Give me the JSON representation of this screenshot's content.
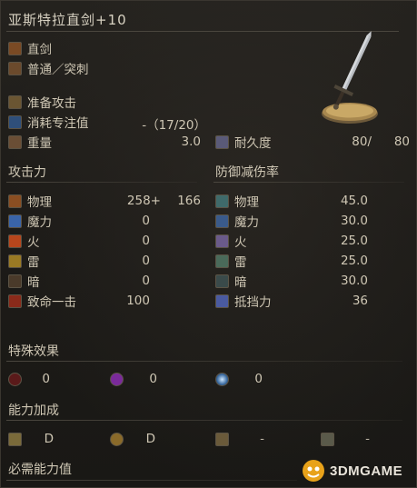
{
  "header": {
    "title": "亚斯特拉直剑+10"
  },
  "weapon": {
    "type": "直剑",
    "attack_type": "普通／突刺",
    "skill": "准备攻击",
    "fp_cost_label": "消耗专注值",
    "fp_cost_value": "-（17/20）",
    "weight_label": "重量",
    "weight_value": "3.0",
    "durability_label": "耐久度",
    "durability_current": "80/",
    "durability_max": "80"
  },
  "attack": {
    "title": "攻击力",
    "rows": [
      {
        "label": "物理",
        "value": "258+",
        "bonus": "166",
        "icon": "physical-attack-icon"
      },
      {
        "label": "魔力",
        "value": "0",
        "icon": "magic-attack-icon"
      },
      {
        "label": "火",
        "value": "0",
        "icon": "fire-attack-icon"
      },
      {
        "label": "雷",
        "value": "0",
        "icon": "lightning-attack-icon"
      },
      {
        "label": "暗",
        "value": "0",
        "icon": "dark-attack-icon"
      },
      {
        "label": "致命一击",
        "value": "100",
        "icon": "critical-icon"
      }
    ]
  },
  "defense": {
    "title": "防御减伤率",
    "rows": [
      {
        "label": "物理",
        "value": "45.0",
        "icon": "physical-defense-icon"
      },
      {
        "label": "魔力",
        "value": "30.0",
        "icon": "magic-defense-icon"
      },
      {
        "label": "火",
        "value": "25.0",
        "icon": "fire-defense-icon"
      },
      {
        "label": "雷",
        "value": "25.0",
        "icon": "lightning-defense-icon"
      },
      {
        "label": "暗",
        "value": "30.0",
        "icon": "dark-defense-icon"
      },
      {
        "label": "抵挡力",
        "value": "36",
        "icon": "stability-icon"
      }
    ]
  },
  "effects": {
    "title": "特殊效果",
    "items": [
      {
        "value": "0",
        "icon": "bleed-icon"
      },
      {
        "value": "0",
        "icon": "poison-icon"
      },
      {
        "value": "0",
        "icon": "frost-icon"
      }
    ]
  },
  "scaling": {
    "title": "能力加成",
    "items": [
      {
        "value": "D",
        "icon": "strength-icon"
      },
      {
        "value": "D",
        "icon": "dexterity-icon"
      },
      {
        "value": "-",
        "icon": "intelligence-icon"
      },
      {
        "value": "-",
        "icon": "faith-icon"
      }
    ]
  },
  "requirements": {
    "title": "必需能力值"
  },
  "watermark": {
    "text": "3DMGAME"
  }
}
